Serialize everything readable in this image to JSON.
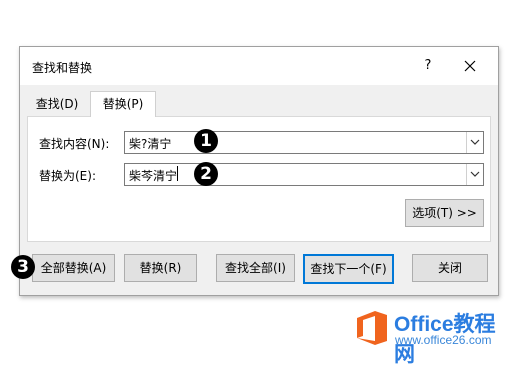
{
  "window": {
    "title": "查找和替换",
    "help_label": "?"
  },
  "tabs": [
    {
      "label": "查找(D)",
      "active": false
    },
    {
      "label": "替换(P)",
      "active": true
    }
  ],
  "find": {
    "label": "查找内容(N):",
    "value": "柴?清宁"
  },
  "replace": {
    "label": "替换为(E):",
    "value": "柴芩清宁"
  },
  "options_button": "选项(T) >>",
  "buttons": {
    "replace_all": "全部替换(A)",
    "replace": "替换(R)",
    "find_all": "查找全部(I)",
    "find_next": "查找下一个(F)",
    "close": "关闭"
  },
  "annotations": [
    "1",
    "2",
    "3"
  ],
  "watermark": {
    "name": "Office教程网",
    "url": "www.office26.com"
  },
  "colors": {
    "focus_border": "#0078d7",
    "logo_orange": "#f0641e",
    "logo_blue": "#2b7de0"
  }
}
